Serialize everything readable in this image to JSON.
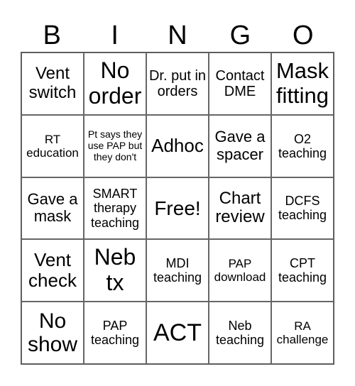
{
  "header": [
    "B",
    "I",
    "N",
    "G",
    "O"
  ],
  "cells": [
    "Vent switch",
    "No order",
    "Dr. put in orders",
    "Contact DME",
    "Mask fitting",
    "RT education",
    "Pt says they use PAP but they don't",
    "Adhoc",
    "Gave a spacer",
    "O2 teaching",
    "Gave a mask",
    "SMART therapy teaching",
    "Free!",
    "Chart review",
    "DCFS teaching",
    "Vent check",
    "Neb tx",
    "MDI teaching",
    "PAP download",
    "CPT teaching",
    "No show",
    "PAP teaching",
    "ACT",
    "Neb teaching",
    "RA challenge"
  ]
}
